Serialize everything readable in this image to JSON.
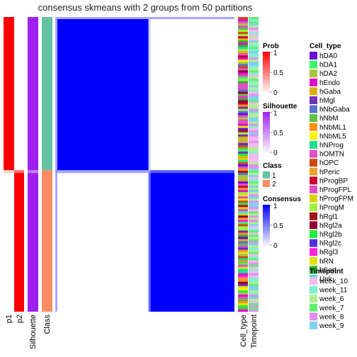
{
  "chart_data": {
    "type": "heatmap",
    "title": "consensus skmeans with 2 groups from 50 partitions",
    "column_annotations_left": [
      "p1",
      "p2",
      "Silhouette",
      "Class"
    ],
    "column_annotations_right": [
      "Cell_type",
      "Timepoint"
    ],
    "groups": [
      {
        "class": "1",
        "fraction": 0.52,
        "p1": 1.0,
        "p2": 0.0,
        "silhouette": 1.0,
        "consensus_within": 1.0
      },
      {
        "class": "2",
        "fraction": 0.48,
        "p1": 0.0,
        "p2": 1.0,
        "silhouette": 1.0,
        "consensus_within": 1.0
      }
    ],
    "legends": {
      "prob": {
        "title": "Prob",
        "ticks": [
          "1",
          "0.5",
          "0"
        ],
        "color_high": "#FF0000",
        "color_low": "#FFFFFF"
      },
      "silhouette": {
        "title": "Silhouette",
        "ticks": [
          "1",
          "0.5",
          "0"
        ],
        "color_high": "#A020F0",
        "color_low": "#FFFFFF"
      },
      "class": {
        "title": "Class",
        "items": [
          {
            "label": "1",
            "color": "#66C2A5"
          },
          {
            "label": "2",
            "color": "#FC8D62"
          }
        ]
      },
      "consensus": {
        "title": "Consensus",
        "ticks": [
          "1",
          "0.5",
          "0"
        ],
        "color_high": "#0000FF",
        "color_low": "#FFFFFF"
      },
      "cell_type": {
        "title": "Cell_type",
        "items": [
          {
            "label": "hDA0",
            "color": "#6A0DDB"
          },
          {
            "label": "hDA1",
            "color": "#3DF56A"
          },
          {
            "label": "hDA2",
            "color": "#A8C43F"
          },
          {
            "label": "hEndo",
            "color": "#E010C8"
          },
          {
            "label": "hGaba",
            "color": "#DDB010"
          },
          {
            "label": "hMgl",
            "color": "#7030B8"
          },
          {
            "label": "hNbGaba",
            "color": "#5A70D0"
          },
          {
            "label": "hNbM",
            "color": "#5EC040"
          },
          {
            "label": "hNbML1",
            "color": "#FF9010"
          },
          {
            "label": "hNbML5",
            "color": "#FFF010"
          },
          {
            "label": "hNProg",
            "color": "#20E090"
          },
          {
            "label": "hOMTN",
            "color": "#E050C0"
          },
          {
            "label": "hOPC",
            "color": "#D04818"
          },
          {
            "label": "hPeric",
            "color": "#E8A030"
          },
          {
            "label": "hProgBP",
            "color": "#C80030"
          },
          {
            "label": "hProgFPL",
            "color": "#E050C8"
          },
          {
            "label": "hProgFPM",
            "color": "#D8D000"
          },
          {
            "label": "hProgM",
            "color": "#A0F040"
          },
          {
            "label": "hRgl1",
            "color": "#A01818"
          },
          {
            "label": "hRgl2a",
            "color": "#900030"
          },
          {
            "label": "hRgl2b",
            "color": "#20F040"
          },
          {
            "label": "hRgl2c",
            "color": "#5030D8"
          },
          {
            "label": "hRgl3",
            "color": "#FF20E0"
          },
          {
            "label": "hRN",
            "color": "#E0E010"
          },
          {
            "label": "hSert",
            "color": "#30B030"
          },
          {
            "label": "Unk",
            "color": "#30F0E0"
          }
        ]
      },
      "timepoint": {
        "title": "Timepoint",
        "items": [
          {
            "label": "week_10",
            "color": "#F8B8F0"
          },
          {
            "label": "week_11",
            "color": "#80F0D0"
          },
          {
            "label": "week_6",
            "color": "#B0F090"
          },
          {
            "label": "week_7",
            "color": "#60F070"
          },
          {
            "label": "week_8",
            "color": "#E090F0"
          },
          {
            "label": "week_9",
            "color": "#80D0F0"
          }
        ]
      }
    }
  }
}
